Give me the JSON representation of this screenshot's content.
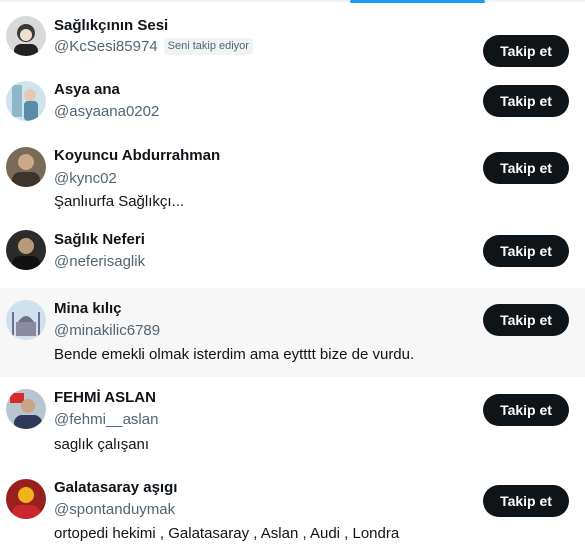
{
  "follow_label": "Takip et",
  "users": [
    {
      "name": "Sağlıkçının Sesi",
      "handle": "@KcSesi85974",
      "badge": "Seni takip ediyor",
      "bio": "",
      "avatar": "portrait-icon"
    },
    {
      "name": "Asya ana",
      "handle": "@asyaana0202",
      "badge": "",
      "bio": "",
      "avatar": "portrait-icon"
    },
    {
      "name": "Koyuncu Abdurrahman",
      "handle": "@kync02",
      "badge": "",
      "bio": "Şanlıurfa Sağlıkçı...",
      "avatar": "portrait-icon"
    },
    {
      "name": "Sağlık Neferi",
      "handle": "@neferisaglik",
      "badge": "",
      "bio": "",
      "avatar": "portrait-icon"
    },
    {
      "name": "Mina kılıç",
      "handle": "@minakilic6789",
      "badge": "",
      "bio": "Bende emekli olmak isterdim ama eytttt bize de vurdu.",
      "avatar": "mosque-icon"
    },
    {
      "name": "FEHMİ ASLAN",
      "handle": "@fehmi__aslan",
      "badge": "",
      "bio": "saglık çalışanı",
      "avatar": "portrait-icon"
    },
    {
      "name": "Galatasaray aşıgı",
      "handle": "@spontanduymak",
      "badge": "",
      "bio": "ortopedi hekimi , Galatasaray , Aslan , Audi , Londra",
      "avatar": "portrait-icon"
    }
  ]
}
